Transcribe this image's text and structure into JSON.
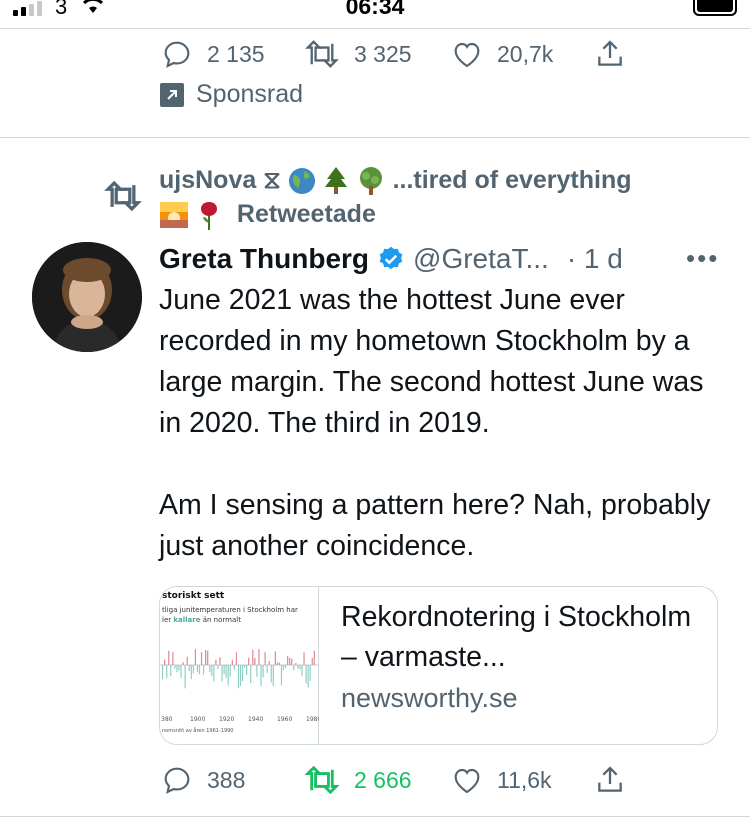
{
  "status_bar": {
    "carrier": "3",
    "time": "06:34"
  },
  "previous_tweet": {
    "replies": "2 135",
    "retweets": "3 325",
    "likes": "20,7k",
    "promoted_label": "Sponsrad"
  },
  "tweet": {
    "retweeter_name": "ujsNova ⧖",
    "retweeter_bio": "...tired of everything",
    "retweeted_label": "Retweetade",
    "author_name": "Greta Thunberg",
    "author_handle": "@GretaT...",
    "time": "· 1 d",
    "more": "•••",
    "text": "June 2021 was the hottest June ever recorded in my hometown Stockholm by a large margin. The second hottest June was in 2020. The third in 2019.\n\nAm I sensing a pattern here? Nah, probably just another coincidence.",
    "card": {
      "thumb_title": "storiskt sett",
      "thumb_subtitle_1": "tliga junitemperaturen i Stockholm har",
      "thumb_subtitle_prefix": "ler",
      "thumb_subtitle_accent": "kallare",
      "thumb_subtitle_suffix": "än normalt",
      "thumb_axis": [
        "380",
        "1900",
        "1920",
        "1940",
        "1960",
        "1980"
      ],
      "thumb_note": "nomsnitt av åren 1961-1990",
      "title": "Rekordnotering i Stockholm – varmaste...",
      "domain": "newsworthy.se"
    },
    "replies": "388",
    "retweets": "2 666",
    "likes": "11,6k"
  },
  "colors": {
    "text_primary": "#0f1419",
    "text_secondary": "#536471",
    "retweet_active": "#17bf63",
    "verified": "#1d9bf0"
  }
}
